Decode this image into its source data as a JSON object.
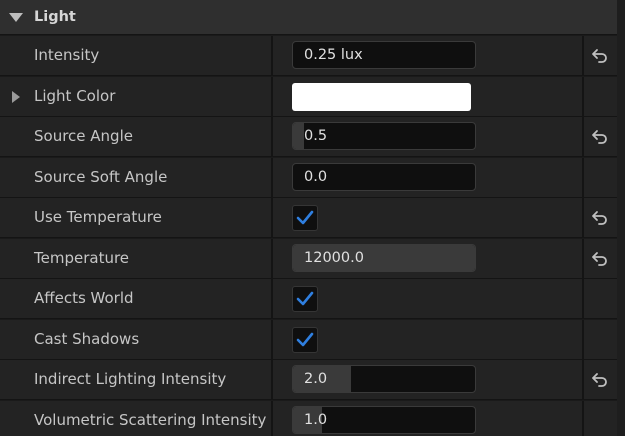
{
  "section": {
    "title": "Light",
    "expanded": true
  },
  "properties": [
    {
      "label": "Intensity",
      "type": "text",
      "value": "0.25 lux",
      "reset": true,
      "fill": 0
    },
    {
      "label": "Light Color",
      "type": "color",
      "color": "#ffffff",
      "reset": false,
      "expandable": true
    },
    {
      "label": "Source Angle",
      "type": "slider",
      "value": "0.5",
      "reset": true,
      "fill": 0.06
    },
    {
      "label": "Source Soft Angle",
      "type": "slider",
      "value": "0.0",
      "reset": false,
      "fill": 0
    },
    {
      "label": "Use Temperature",
      "type": "checkbox",
      "checked": true,
      "reset": true
    },
    {
      "label": "Temperature",
      "type": "slider",
      "value": "12000.0",
      "reset": true,
      "fill": 1.0
    },
    {
      "label": "Affects World",
      "type": "checkbox",
      "checked": true,
      "reset": false
    },
    {
      "label": "Cast Shadows",
      "type": "checkbox",
      "checked": true,
      "reset": false
    },
    {
      "label": "Indirect Lighting Intensity",
      "type": "slider",
      "value": "2.0",
      "reset": true,
      "fill": 0.32
    },
    {
      "label": "Volumetric Scattering Intensity",
      "type": "slider",
      "value": "1.0",
      "reset": false,
      "fill": 0.16
    }
  ],
  "colors": {
    "checkmark": "#2f7fe0",
    "slider_fill": "#3a3a3a",
    "reset_icon": "#c0c0c0"
  },
  "icons": {
    "section_toggle": "triangle-down-icon",
    "expander": "triangle-right-icon",
    "reset": "reset-arrow-icon",
    "check": "checkmark-icon"
  }
}
